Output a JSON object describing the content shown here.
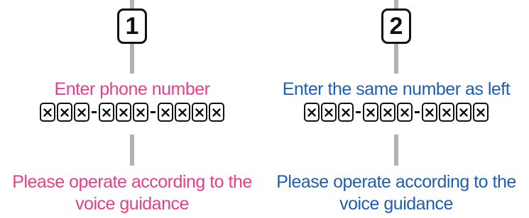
{
  "left": {
    "step_number": "1",
    "title": "Enter phone number",
    "number_mask": "xxx-xxx-xxxx",
    "guidance": "Please operate according to the voice guidance",
    "color": "#e83e8c"
  },
  "right": {
    "step_number": "2",
    "title": "Enter the same number as left",
    "number_mask": "xxx-xxx-xxxx",
    "guidance": "Please operate according to the voice guidance",
    "color": "#1d5fb3"
  }
}
